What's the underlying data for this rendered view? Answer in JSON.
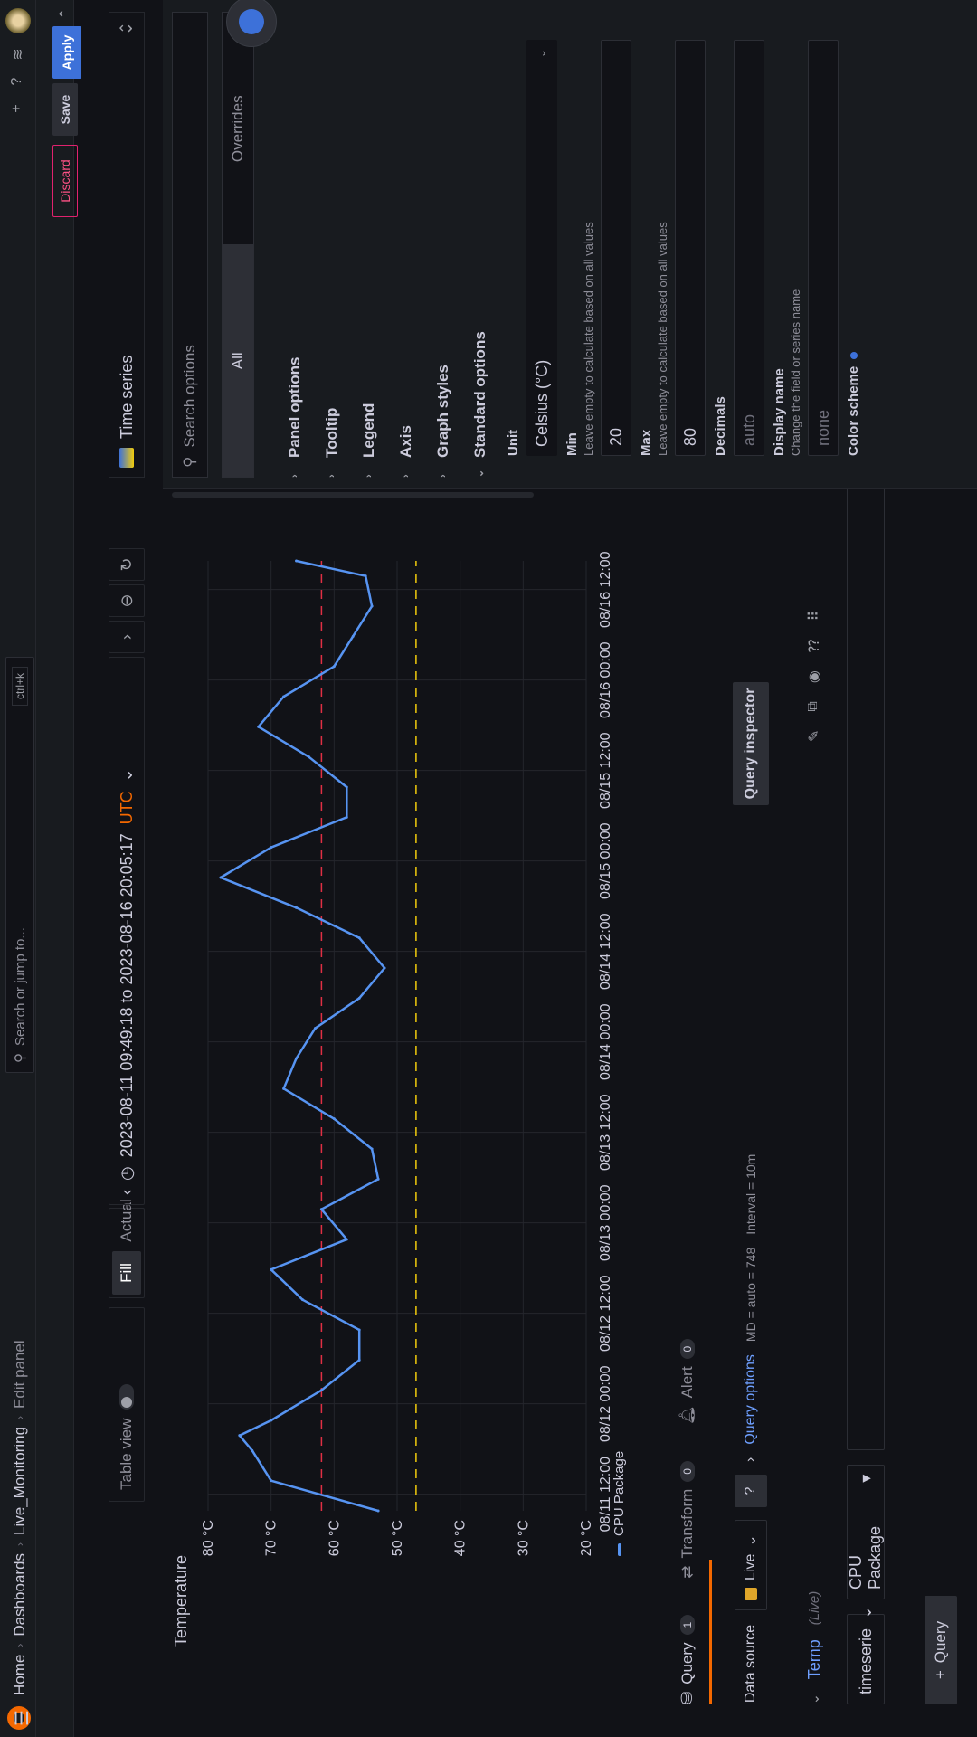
{
  "topbar": {
    "search_placeholder": "Search or jump to...",
    "search_shortcut": "ctrl+k"
  },
  "breadcrumb": [
    "Home",
    "Dashboards",
    "Live_Monitoring",
    "Edit panel"
  ],
  "actions": {
    "discard": "Discard",
    "save": "Save",
    "apply": "Apply"
  },
  "toolbar": {
    "table_view": "Table view",
    "fill": "Fill",
    "actual": "Actual",
    "time_range": "2023-08-11 09:49:18 to 2023-08-16 20:05:17",
    "timezone": "UTC"
  },
  "panel": {
    "title": "Temperature",
    "legend": "CPU Package"
  },
  "chart_data": {
    "type": "line",
    "ylim": [
      20,
      80
    ],
    "yticks": [
      "20 °C",
      "30 °C",
      "40 °C",
      "50 °C",
      "60 °C",
      "70 °C",
      "80 °C"
    ],
    "xticks": [
      "08/11 12:00",
      "08/12 00:00",
      "08/12 12:00",
      "08/13 00:00",
      "08/13 12:00",
      "08/14 00:00",
      "08/14 12:00",
      "08/15 00:00",
      "08/15 12:00",
      "08/16 00:00",
      "08/16 12:00"
    ],
    "thresholds": [
      {
        "value": 62,
        "color": "#e02f44"
      },
      {
        "value": 47,
        "color": "#f2cc0c"
      }
    ],
    "series": [
      {
        "name": "CPU Package",
        "color": "#5794f2",
        "x_hours": [
          0,
          4,
          8,
          10,
          12,
          16,
          20,
          24,
          28,
          32,
          36,
          40,
          44,
          48,
          52,
          56,
          60,
          64,
          68,
          72,
          76,
          80,
          84,
          88,
          92,
          96,
          100,
          104,
          108,
          112,
          116,
          120,
          124,
          126
        ],
        "values": [
          53,
          70,
          73,
          75,
          70,
          62,
          56,
          56,
          65,
          70,
          58,
          62,
          53,
          54,
          60,
          68,
          66,
          63,
          56,
          52,
          56,
          66,
          78,
          70,
          58,
          58,
          64,
          72,
          68,
          60,
          57,
          54,
          55,
          66
        ]
      }
    ]
  },
  "query_tabs": [
    {
      "label": "Query",
      "count": "1"
    },
    {
      "label": "Transform",
      "count": "0"
    },
    {
      "label": "Alert",
      "count": "0"
    }
  ],
  "query_bar": {
    "data_source_label": "Data source",
    "data_source": "Live",
    "query_options": "Query options",
    "md_info": "MD = auto = 748",
    "interval_info": "Interval = 10m",
    "inspector": "Query inspector"
  },
  "query_row": {
    "name": "Temp",
    "tag": "(Live)",
    "select1": "timeserie",
    "select2": "CPU Package"
  },
  "add_query": "Query",
  "options": {
    "viz": "Time series",
    "search_placeholder": "Search options",
    "tabs": [
      "All",
      "Overrides"
    ],
    "sections": [
      "Panel options",
      "Tooltip",
      "Legend",
      "Axis",
      "Graph styles",
      "Standard options"
    ],
    "unit_label": "Unit",
    "unit_value": "Celsius (°C)",
    "min_label": "Min",
    "min_desc": "Leave empty to calculate based on all values",
    "min_value": "20",
    "max_label": "Max",
    "max_desc": "Leave empty to calculate based on all values",
    "max_value": "80",
    "decimals_label": "Decimals",
    "decimals_value": "auto",
    "display_name_label": "Display name",
    "display_name_desc": "Change the field or series name",
    "display_name_value": "none",
    "color_scheme_label": "Color scheme"
  }
}
